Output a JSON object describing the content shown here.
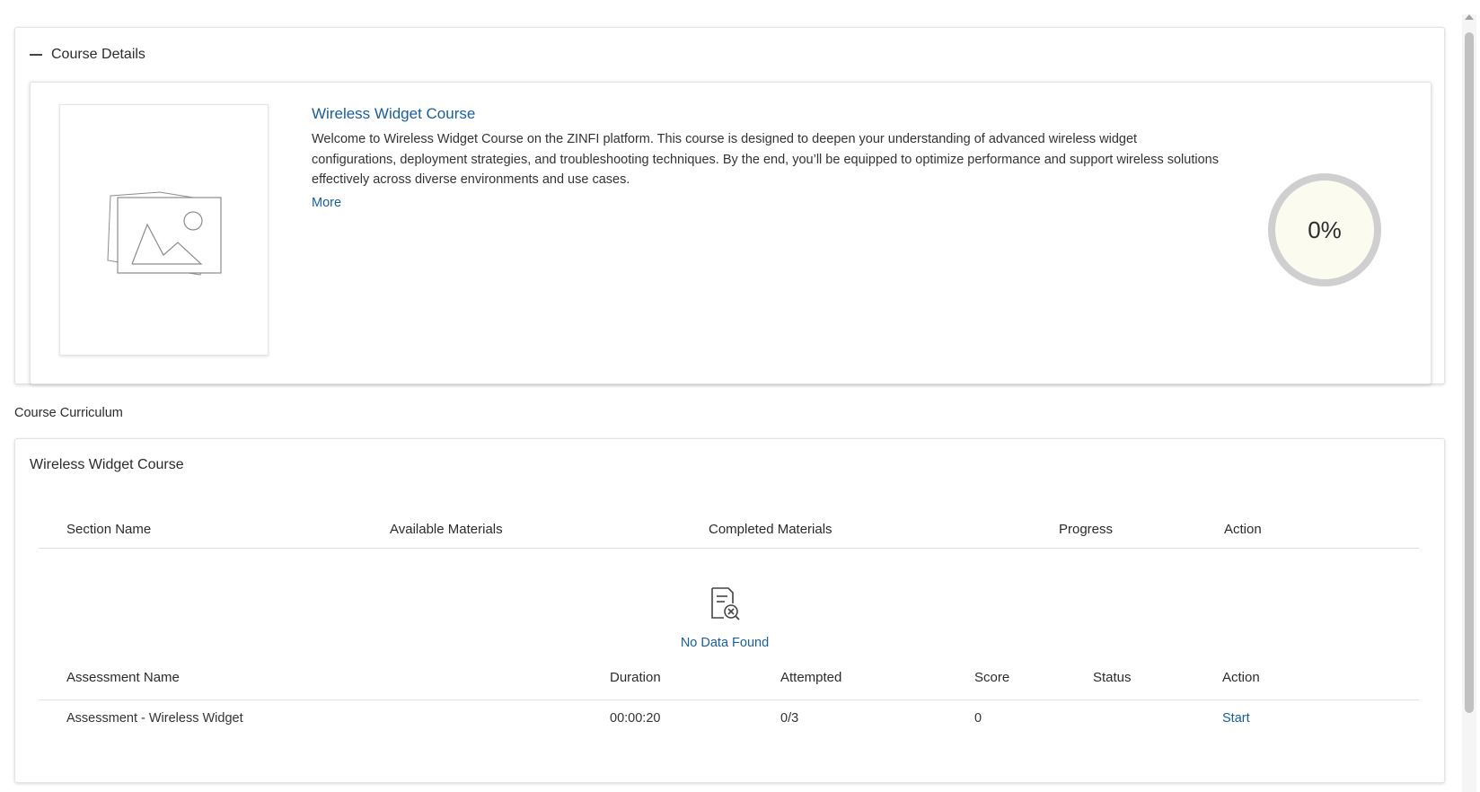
{
  "details": {
    "header_title": "Course Details",
    "course_title": "Wireless Widget Course",
    "description": "Welcome to Wireless Widget Course on the ZINFI platform. This course is designed to deepen your understanding of advanced wireless widget configurations, deployment strategies, and troubleshooting techniques. By the end, you’ll be equipped to optimize performance and support wireless solutions effectively across diverse environments and use cases.",
    "more_label": "More",
    "progress_label": "0%",
    "progress_fraction": 0,
    "image_icon": "image-placeholder-icon",
    "collapse_icon": "minus-icon"
  },
  "curriculum": {
    "section_label": "Course Curriculum",
    "course_title": "Wireless Widget Course",
    "sections_table": {
      "headers": [
        "Section Name",
        "Available Materials",
        "Completed Materials",
        "Progress",
        "Action"
      ],
      "empty_text": "No Data Found",
      "empty_icon": "document-x-icon"
    },
    "assessments_table": {
      "headers": [
        "Assessment Name",
        "Duration",
        "Attempted",
        "Score",
        "Status",
        "Action"
      ],
      "rows": [
        {
          "name": "Assessment - Wireless Widget",
          "duration": "00:00:20",
          "attempted": "0/3",
          "score": "0",
          "status": "",
          "action": "Start"
        }
      ]
    }
  },
  "colors": {
    "link": "#1a5e99",
    "ring_track": "#cfcfcf",
    "ring_fill": "#fbfbf0"
  }
}
